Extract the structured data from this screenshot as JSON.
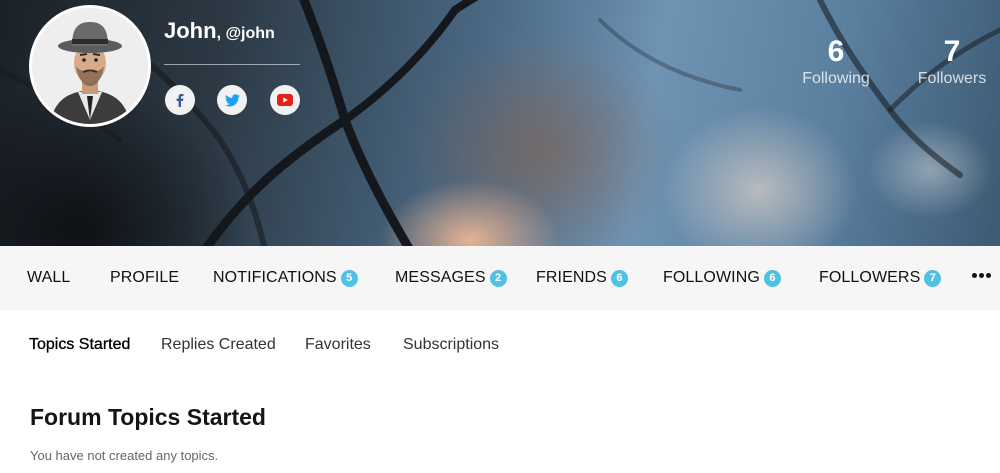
{
  "profile": {
    "name": "John",
    "handle": ", @john"
  },
  "social": [
    {
      "icon": "facebook-icon",
      "color": "#3b5998",
      "glyph": "f"
    },
    {
      "icon": "twitter-icon",
      "color": "#1da1f2"
    },
    {
      "icon": "youtube-icon",
      "color": "#e62117"
    }
  ],
  "stats": {
    "following": {
      "value": "6",
      "label": "Following"
    },
    "followers": {
      "value": "7",
      "label": "Followers"
    }
  },
  "nav": {
    "items": [
      {
        "label": "WALL"
      },
      {
        "label": "PROFILE"
      },
      {
        "label": "NOTIFICATIONS",
        "badge": "5"
      },
      {
        "label": "MESSAGES",
        "badge": "2"
      },
      {
        "label": "FRIENDS",
        "badge": "6"
      },
      {
        "label": "FOLLOWING",
        "badge": "6"
      },
      {
        "label": "FOLLOWERS",
        "badge": "7"
      }
    ],
    "more_icon": "more-dots-icon",
    "badge_color": "#4fc1e3"
  },
  "subnav": {
    "items": [
      {
        "label": "Topics Started",
        "active": true
      },
      {
        "label": "Replies Created"
      },
      {
        "label": "Favorites"
      },
      {
        "label": "Subscriptions"
      }
    ]
  },
  "content": {
    "title": "Forum Topics Started",
    "empty_message": "You have not created any topics."
  }
}
